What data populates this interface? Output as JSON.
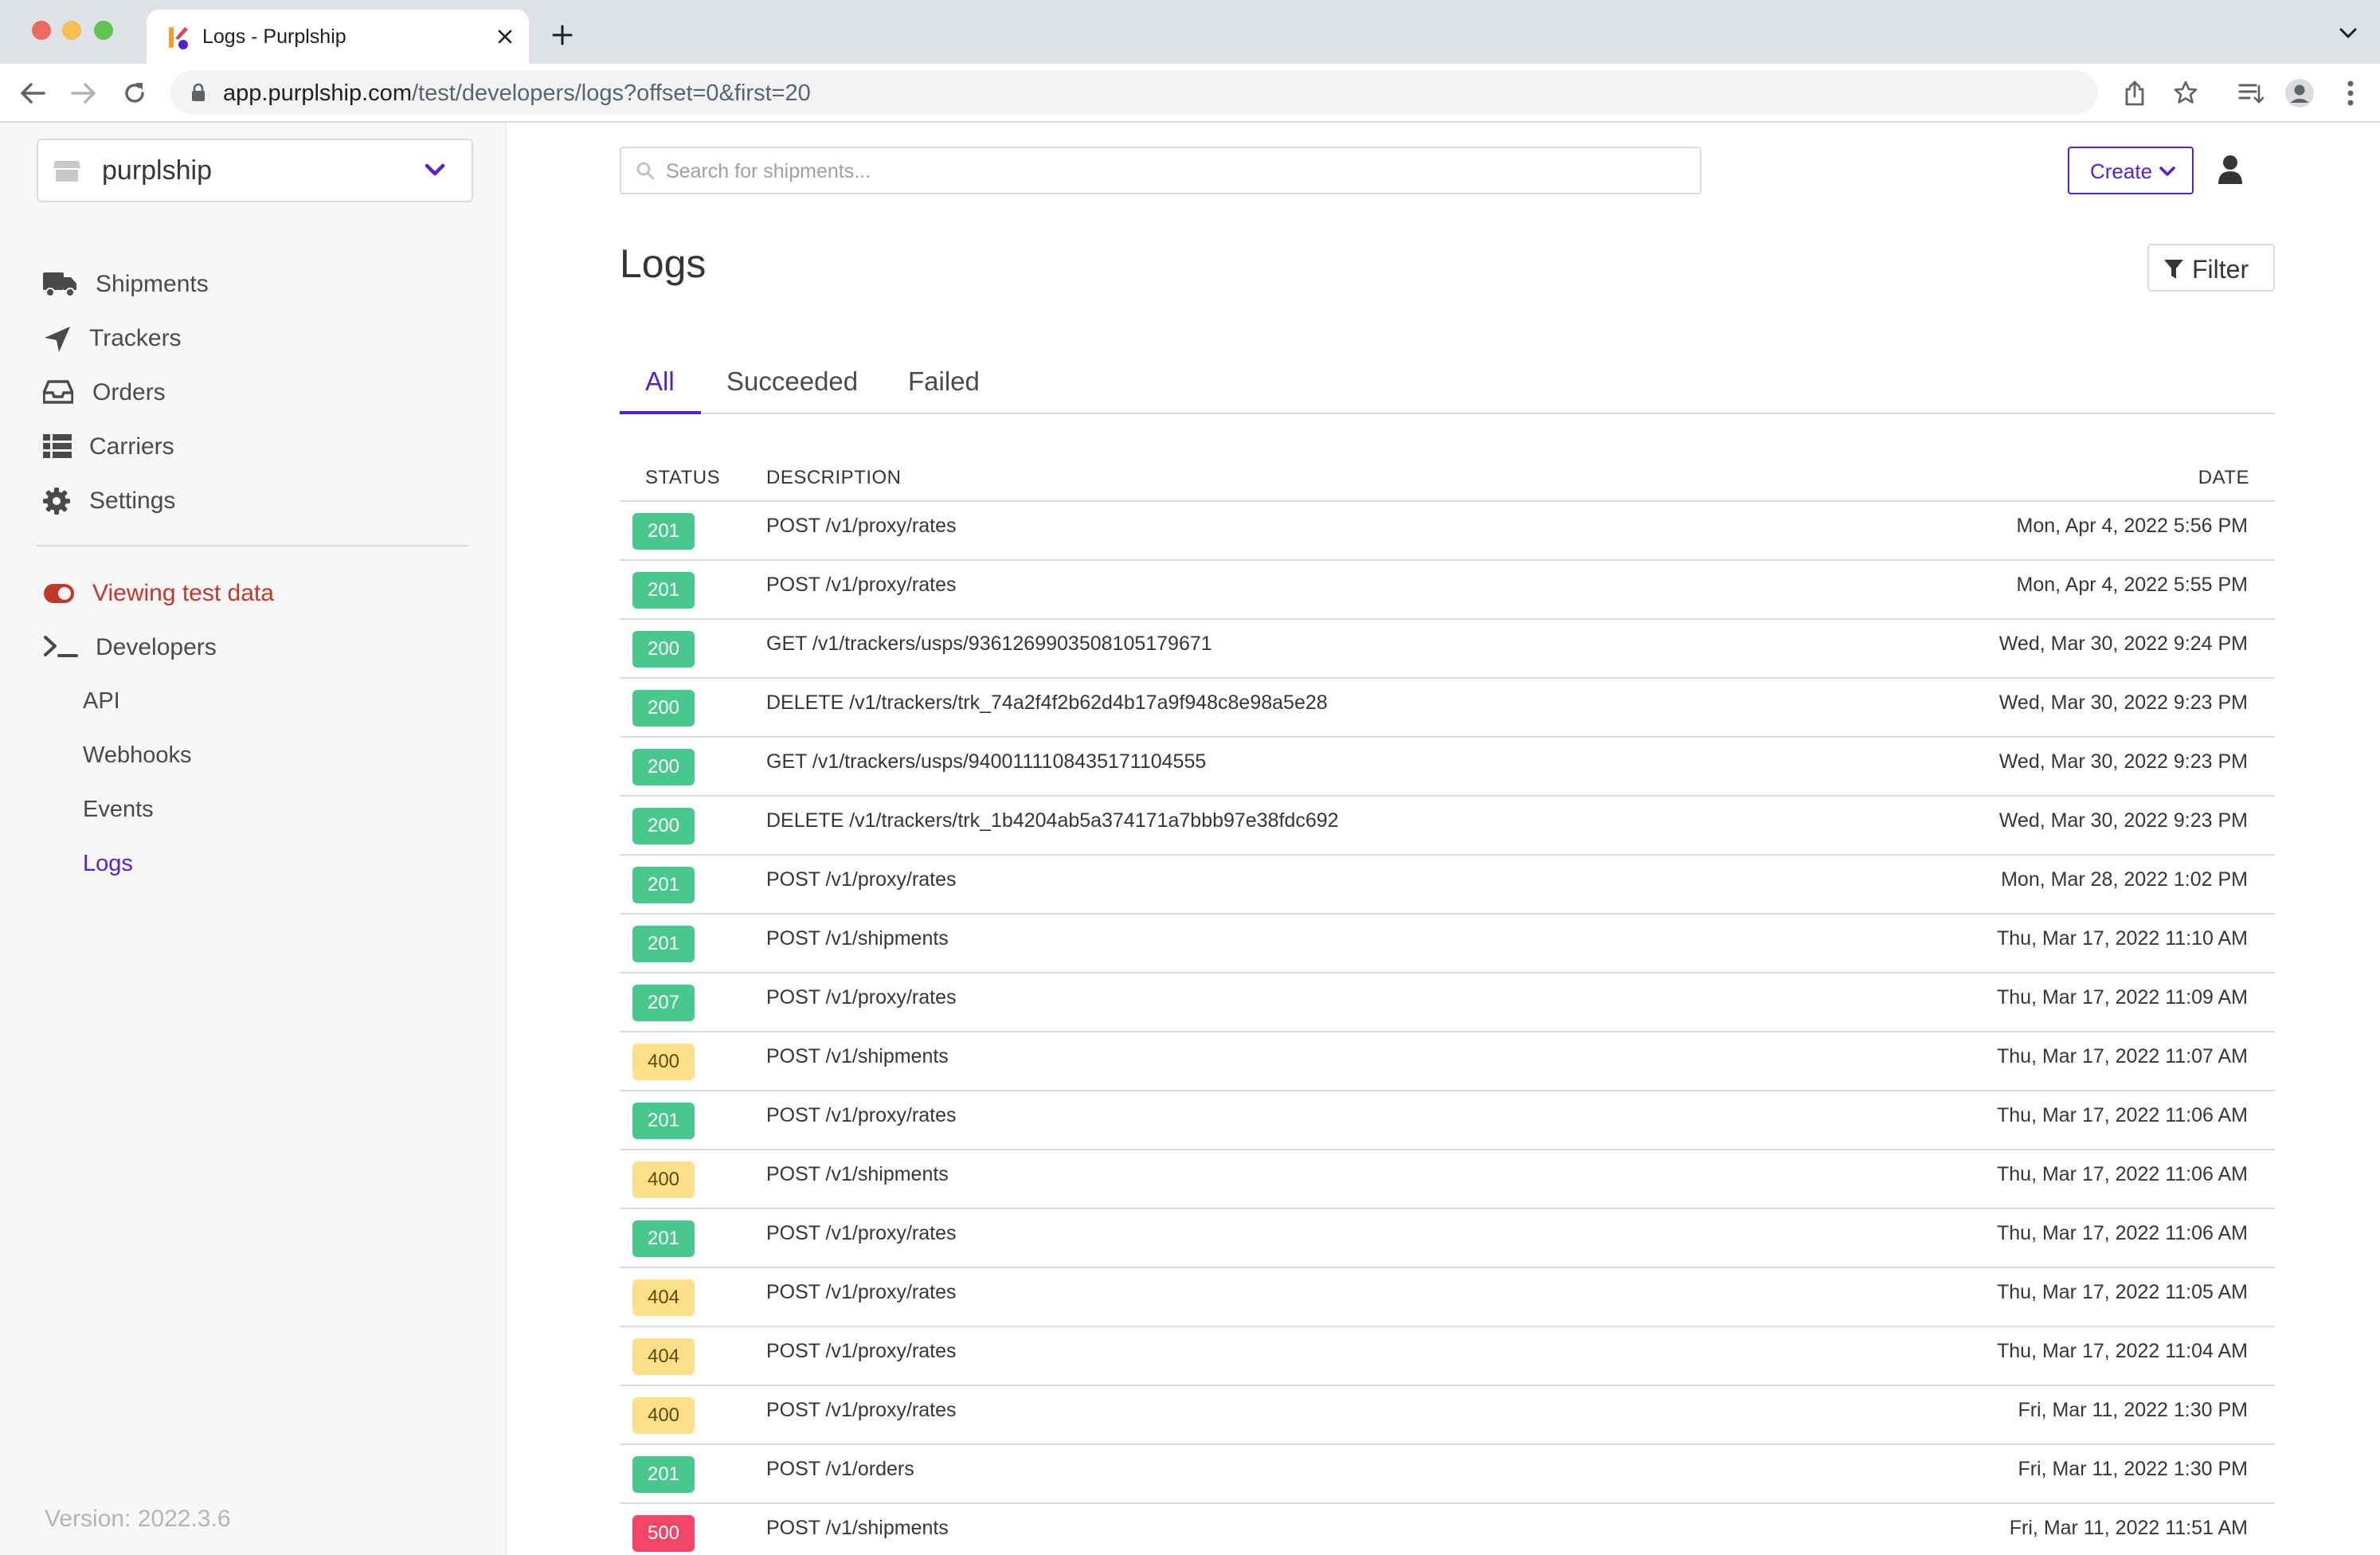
{
  "browser": {
    "tab_title": "Logs - Purplship",
    "url_host": "app.purplship.com",
    "url_path": "/test/developers/logs?offset=0&first=20"
  },
  "sidebar": {
    "org_name": "purplship",
    "nav": [
      {
        "label": "Shipments",
        "icon": "truck-icon"
      },
      {
        "label": "Trackers",
        "icon": "location-arrow-icon"
      },
      {
        "label": "Orders",
        "icon": "inbox-icon"
      },
      {
        "label": "Carriers",
        "icon": "list-icon"
      },
      {
        "label": "Settings",
        "icon": "gear-icon"
      }
    ],
    "test_mode_label": "Viewing test data",
    "developers_label": "Developers",
    "developer_items": [
      "API",
      "Webhooks",
      "Events",
      "Logs"
    ],
    "active_item": "Logs",
    "version": "Version: 2022.3.6"
  },
  "header": {
    "search_placeholder": "Search for shipments...",
    "create_label": "Create"
  },
  "page": {
    "title": "Logs",
    "filter_label": "Filter",
    "tabs": [
      "All",
      "Succeeded",
      "Failed"
    ],
    "active_tab": "All"
  },
  "table": {
    "columns": [
      "STATUS",
      "DESCRIPTION",
      "DATE"
    ],
    "rows": [
      {
        "status": "201",
        "description": "POST /v1/proxy/rates",
        "date": "Mon, Apr 4, 2022 5:56 PM"
      },
      {
        "status": "201",
        "description": "POST /v1/proxy/rates",
        "date": "Mon, Apr 4, 2022 5:55 PM"
      },
      {
        "status": "200",
        "description": "GET /v1/trackers/usps/9361269903508105179671",
        "date": "Wed, Mar 30, 2022 9:24 PM"
      },
      {
        "status": "200",
        "description": "DELETE /v1/trackers/trk_74a2f4f2b62d4b17a9f948c8e98a5e28",
        "date": "Wed, Mar 30, 2022 9:23 PM"
      },
      {
        "status": "200",
        "description": "GET /v1/trackers/usps/9400111108435171104555",
        "date": "Wed, Mar 30, 2022 9:23 PM"
      },
      {
        "status": "200",
        "description": "DELETE /v1/trackers/trk_1b4204ab5a374171a7bbb97e38fdc692",
        "date": "Wed, Mar 30, 2022 9:23 PM"
      },
      {
        "status": "201",
        "description": "POST /v1/proxy/rates",
        "date": "Mon, Mar 28, 2022 1:02 PM"
      },
      {
        "status": "201",
        "description": "POST /v1/shipments",
        "date": "Thu, Mar 17, 2022 11:10 AM"
      },
      {
        "status": "207",
        "description": "POST /v1/proxy/rates",
        "date": "Thu, Mar 17, 2022 11:09 AM"
      },
      {
        "status": "400",
        "description": "POST /v1/shipments",
        "date": "Thu, Mar 17, 2022 11:07 AM"
      },
      {
        "status": "201",
        "description": "POST /v1/proxy/rates",
        "date": "Thu, Mar 17, 2022 11:06 AM"
      },
      {
        "status": "400",
        "description": "POST /v1/shipments",
        "date": "Thu, Mar 17, 2022 11:06 AM"
      },
      {
        "status": "201",
        "description": "POST /v1/proxy/rates",
        "date": "Thu, Mar 17, 2022 11:06 AM"
      },
      {
        "status": "404",
        "description": "POST /v1/proxy/rates",
        "date": "Thu, Mar 17, 2022 11:05 AM"
      },
      {
        "status": "404",
        "description": "POST /v1/proxy/rates",
        "date": "Thu, Mar 17, 2022 11:04 AM"
      },
      {
        "status": "400",
        "description": "POST /v1/proxy/rates",
        "date": "Fri, Mar 11, 2022 1:30 PM"
      },
      {
        "status": "201",
        "description": "POST /v1/orders",
        "date": "Fri, Mar 11, 2022 1:30 PM"
      },
      {
        "status": "500",
        "description": "POST /v1/shipments",
        "date": "Fri, Mar 11, 2022 11:51 AM"
      }
    ]
  },
  "colors": {
    "accent": "#5722cc",
    "success": "#48c78e",
    "warning": "#ffe08a",
    "danger": "#f14668",
    "test_mode": "#c0392b"
  }
}
